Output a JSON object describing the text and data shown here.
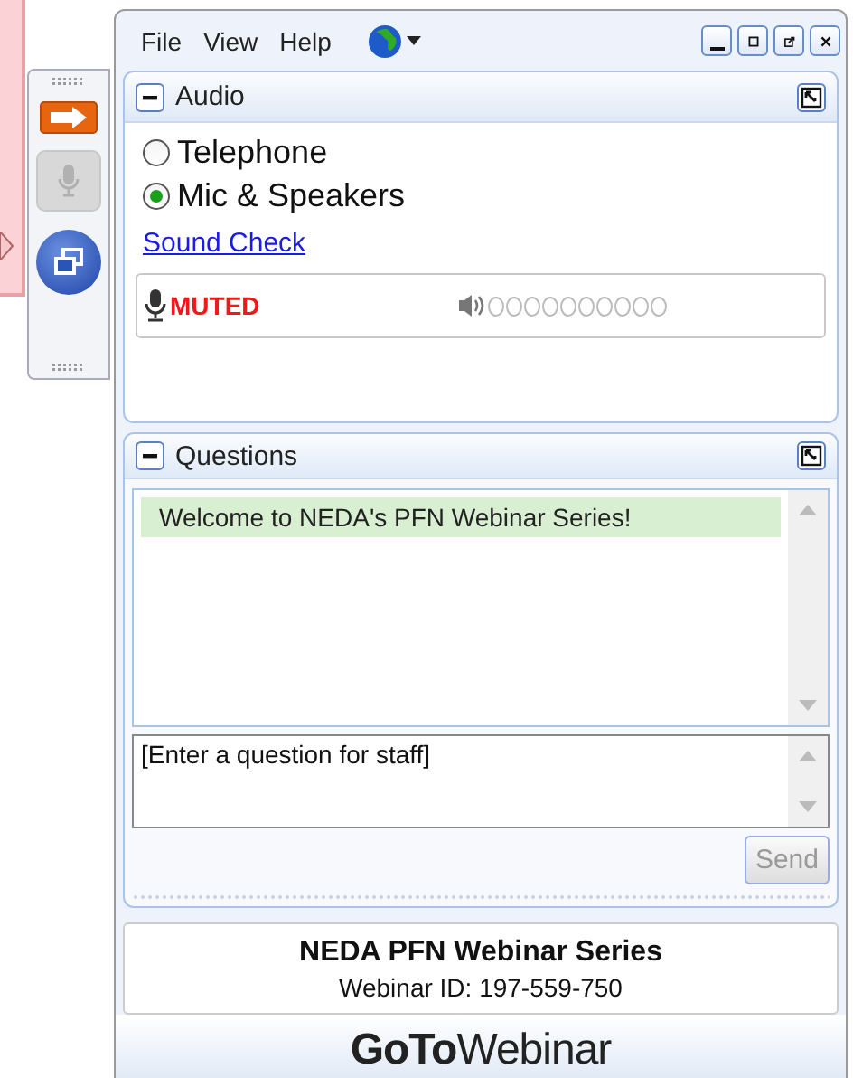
{
  "toolbar": [
    {
      "kind": "arrow",
      "disabled": false
    },
    {
      "kind": "mic",
      "disabled": true
    },
    {
      "kind": "windows",
      "disabled": false
    }
  ],
  "menu": [
    {
      "label": "File"
    },
    {
      "label": "View"
    },
    {
      "label": "Help"
    }
  ],
  "audio": {
    "title": "Audio",
    "expanded": true,
    "options": [
      {
        "label": "Telephone",
        "selected": false
      },
      {
        "label": "Mic & Speakers",
        "selected": true
      }
    ],
    "link": "Sound Check",
    "mic_status": "MUTED"
  },
  "questions": {
    "title": "Questions",
    "expanded": true,
    "messages": [
      "Welcome to NEDA's PFN Webinar Series!"
    ],
    "placeholder": "[Enter a question for staff]",
    "send": {
      "label": "Send",
      "disabled": true
    }
  },
  "webinar": {
    "name": "NEDA PFN Webinar Series",
    "id_text": "Webinar ID: 197-559-750"
  },
  "brand": "**GoTo**Webinar"
}
